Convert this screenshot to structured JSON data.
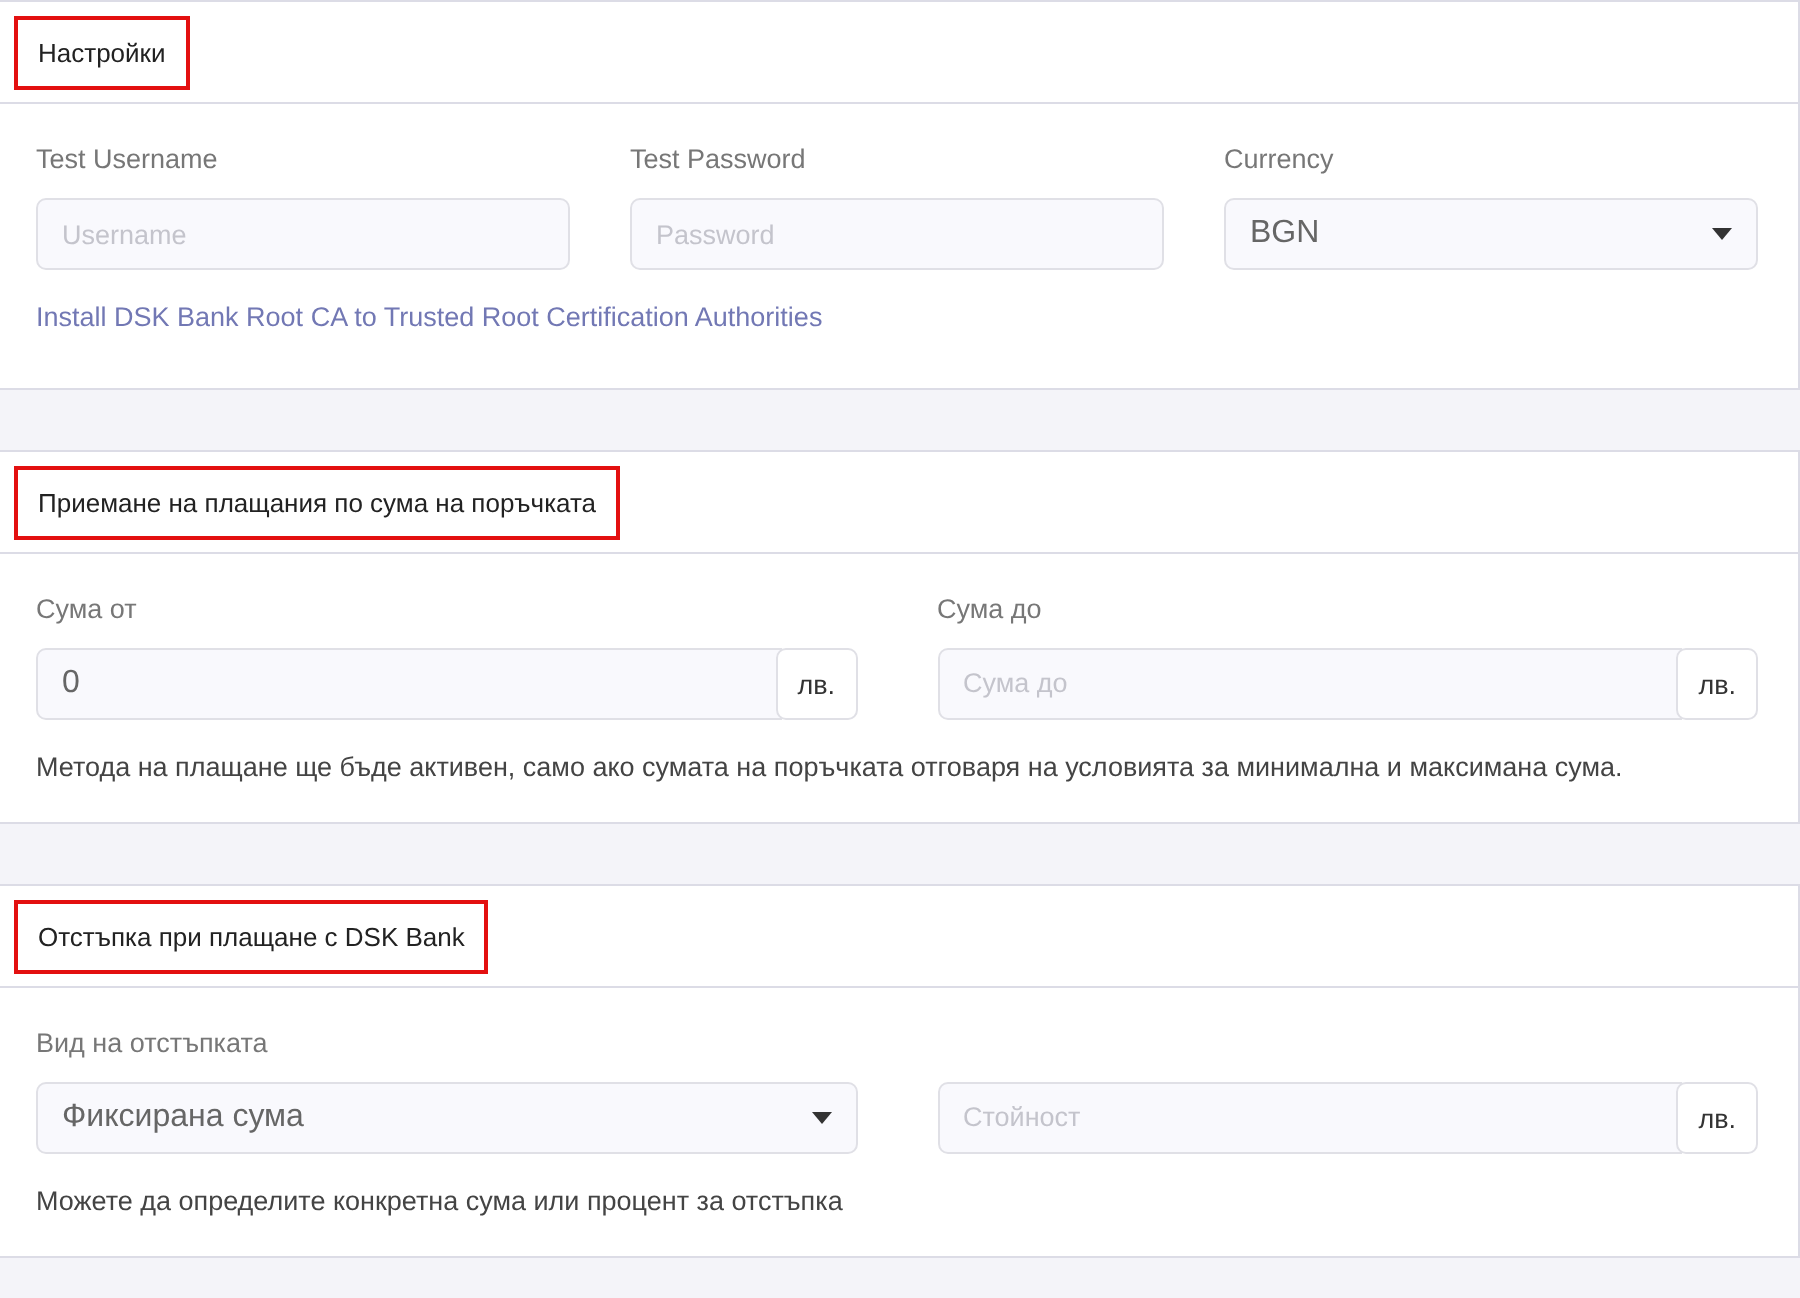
{
  "sections": [
    {
      "title": "Настройки",
      "highlighted": true,
      "fields": [
        {
          "kind": "text",
          "label": "Test Username",
          "placeholder": "Username"
        },
        {
          "kind": "text",
          "label": "Test Password",
          "placeholder": "Password"
        },
        {
          "kind": "select",
          "label": "Currency",
          "value": "BGN"
        }
      ],
      "link": "Install DSK Bank Root CA to Trusted Root Certification Authorities"
    },
    {
      "title": "Приемане на плащания по сума на поръчката",
      "highlighted": true,
      "fields": [
        {
          "kind": "addon",
          "label": "Сума от",
          "value": "0",
          "addon": "лв."
        },
        {
          "kind": "addon",
          "label": "Сума до",
          "placeholder": "Сума до",
          "addon": "лв."
        }
      ],
      "note": "Метода на плащане ще бъде активен, само ако сумата на поръчката отговаря на условията за минимална и максимана сума."
    },
    {
      "title": "Отстъпка при плащане с DSK Bank",
      "highlighted": true,
      "fields": [
        {
          "kind": "select",
          "label": "Вид на отстъпката",
          "value": "Фиксирана сума"
        },
        {
          "kind": "addon",
          "placeholder": "Стойност",
          "addon": "лв."
        }
      ],
      "note": "Можете да определите конкретна сума или процент за отстъпка"
    }
  ]
}
